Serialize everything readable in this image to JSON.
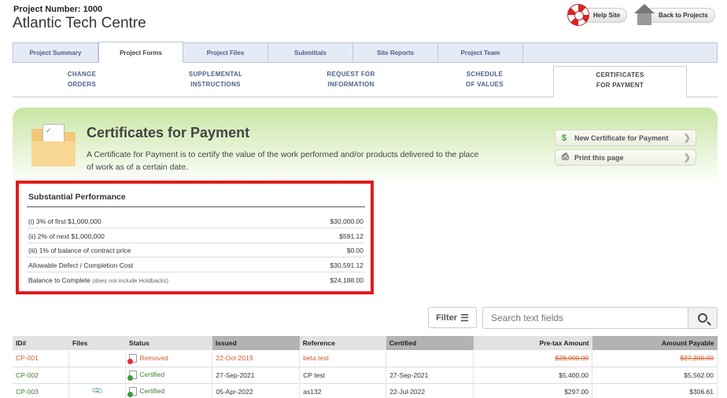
{
  "project": {
    "number_label": "Project Number: 1000",
    "name": "Atlantic Tech Centre"
  },
  "header": {
    "help_label": "Help Site",
    "back_label": "Back to Projects"
  },
  "tabs": [
    "Project Summary",
    "Project Forms",
    "Project Files",
    "Submittals",
    "Site Reports",
    "Project Team"
  ],
  "subtabs": [
    {
      "line1": "CHANGE",
      "line2": "ORDERS"
    },
    {
      "line1": "SUPPLEMENTAL",
      "line2": "INSTRUCTIONS"
    },
    {
      "line1": "REQUEST FOR",
      "line2": "INFORMATION"
    },
    {
      "line1": "SCHEDULE",
      "line2": "OF VALUES"
    },
    {
      "line1": "CERTIFICATES",
      "line2": "FOR PAYMENT"
    }
  ],
  "banner": {
    "title": "Certificates for Payment",
    "description": "A Certificate for Payment is to certify the value of the work performed and/or products delivered to the place of work as of a certain date.",
    "new_button": "New Certificate for Payment",
    "print_button": "Print this page"
  },
  "substantial": {
    "title": "Substantial Performance",
    "rows": [
      {
        "label": "(i) 3% of first $1,000,000",
        "note": "",
        "value": "$30,000.00"
      },
      {
        "label": "(ii) 2% of next $1,000,000",
        "note": "",
        "value": "$591.12"
      },
      {
        "label": "(iii) 1% of balance of contract price",
        "note": "",
        "value": "$0.00"
      },
      {
        "label": "Allowable Defect / Completion Cost",
        "note": "",
        "value": "$30,591.12"
      },
      {
        "label": "Balance to Complete",
        "note": "(does not include Holdbacks)",
        "value": "$24,188.00"
      }
    ]
  },
  "filter_label": "Filter",
  "search": {
    "placeholder": "Search text fields"
  },
  "table": {
    "headers": [
      "ID#",
      "Files",
      "Status",
      "Issued",
      "Reference",
      "Certified",
      "Pre-tax Amount",
      "Amount Payable"
    ],
    "rows": [
      {
        "id": "CP-001",
        "status": "Removed",
        "issued": "22-Oct-2019",
        "reference": "beta test",
        "certified": "",
        "pretax": "$28,000.00",
        "payable": "$27,300.00"
      },
      {
        "id": "CP-002",
        "status": "Certified",
        "issued": "27-Sep-2021",
        "reference": "CP test",
        "certified": "27-Sep-2021",
        "pretax": "$5,400.00",
        "payable": "$5,562.00"
      },
      {
        "id": "CP-003",
        "status": "Certified",
        "issued": "05-Apr-2022",
        "reference": "as132",
        "certified": "22-Jul-2022",
        "pretax": "$297.00",
        "payable": "$306.61"
      }
    ]
  },
  "colors": {
    "removed": "#d85a2a",
    "certified_green": "#3a9e3a",
    "red_highlight": "#e01c1c"
  }
}
